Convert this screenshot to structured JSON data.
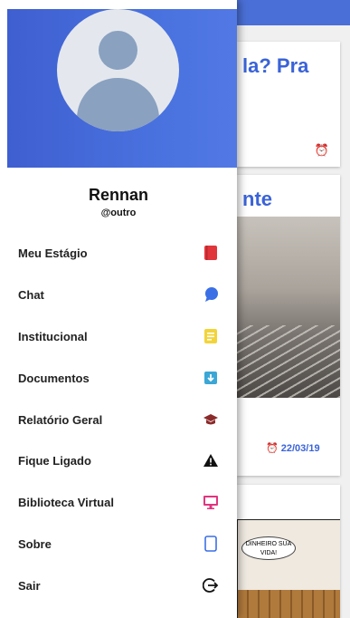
{
  "user": {
    "name": "Rennan",
    "handle": "@outro"
  },
  "menu": {
    "items": [
      {
        "label": "Meu Estágio",
        "icon": "book-icon",
        "color": "#e0353b"
      },
      {
        "label": "Chat",
        "icon": "chat-bubble-icon",
        "color": "#3b6fe6"
      },
      {
        "label": "Institucional",
        "icon": "note-icon",
        "color": "#f2d43a"
      },
      {
        "label": "Documentos",
        "icon": "archive-icon",
        "color": "#3aa7d6"
      },
      {
        "label": "Relatório Geral",
        "icon": "graduation-cap-icon",
        "color": "#8b2a2a"
      },
      {
        "label": "Fique Ligado",
        "icon": "warning-icon",
        "color": "#111111"
      },
      {
        "label": "Biblioteca Virtual",
        "icon": "monitor-icon",
        "color": "#e0357f"
      },
      {
        "label": "Sobre",
        "icon": "tablet-icon",
        "color": "#3b6fe6"
      },
      {
        "label": "Sair",
        "icon": "logout-icon",
        "color": "#111111"
      }
    ]
  },
  "background": {
    "card1": {
      "title": "la? Pra"
    },
    "card2": {
      "title": "nte",
      "date": "22/03/19"
    },
    "card3": {
      "comic_text": "DINHEIRO SUA VIDA!"
    }
  },
  "colors": {
    "accent": "#4a6fd6",
    "title_blue": "#3a63d8"
  }
}
